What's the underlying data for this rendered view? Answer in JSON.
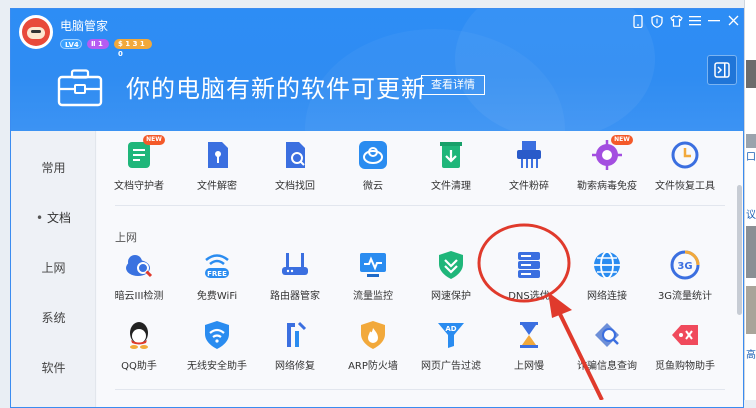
{
  "app": {
    "title": "电脑管家",
    "badges": [
      "LV4",
      "Ⅱ 1",
      "$ 1 3 1 0"
    ]
  },
  "window_controls": [
    "phone-icon",
    "shield-icon",
    "shirt-icon",
    "menu-icon",
    "minimize-icon",
    "close-icon"
  ],
  "banner": {
    "notice": "你的电脑有新的软件可更新",
    "detail_button": "查看详情"
  },
  "sidebar": {
    "items": [
      {
        "label": "常用",
        "active": false
      },
      {
        "label": "文档",
        "active": true
      },
      {
        "label": "上网",
        "active": false
      },
      {
        "label": "系统",
        "active": false
      },
      {
        "label": "软件",
        "active": false
      }
    ]
  },
  "sections": {
    "docs_tools": [
      {
        "label": "文档守护者",
        "icon": "doc-guard-icon",
        "new": true
      },
      {
        "label": "文件解密",
        "icon": "file-decrypt-icon",
        "new": false
      },
      {
        "label": "文档找回",
        "icon": "doc-recover-icon",
        "new": false
      },
      {
        "label": "微云",
        "icon": "weiyun-icon",
        "new": false
      },
      {
        "label": "文件清理",
        "icon": "file-clean-icon",
        "new": false
      },
      {
        "label": "文件粉碎",
        "icon": "file-shred-icon",
        "new": false
      },
      {
        "label": "勒索病毒免疫",
        "icon": "ransomware-immune-icon",
        "new": true
      },
      {
        "label": "文件恢复工具",
        "icon": "file-restore-icon",
        "new": false
      }
    ],
    "network": {
      "label": "上网",
      "row1": [
        {
          "label": "暗云III检测",
          "icon": "cloud-scan-icon"
        },
        {
          "label": "免费WiFi",
          "icon": "free-wifi-icon"
        },
        {
          "label": "路由器管家",
          "icon": "router-icon"
        },
        {
          "label": "流量监控",
          "icon": "traffic-monitor-icon"
        },
        {
          "label": "网速保护",
          "icon": "speed-protect-icon"
        },
        {
          "label": "DNS选优",
          "icon": "dns-server-icon"
        },
        {
          "label": "网络连接",
          "icon": "globe-icon"
        },
        {
          "label": "3G流量统计",
          "icon": "3g-stats-icon"
        }
      ],
      "row2": [
        {
          "label": "QQ助手",
          "icon": "qq-icon"
        },
        {
          "label": "无线安全助手",
          "icon": "wifi-shield-icon"
        },
        {
          "label": "网络修复",
          "icon": "network-repair-icon"
        },
        {
          "label": "ARP防火墙",
          "icon": "arp-firewall-icon"
        },
        {
          "label": "网页广告过滤",
          "icon": "ad-filter-icon"
        },
        {
          "label": "上网慢",
          "icon": "hourglass-icon"
        },
        {
          "label": "诈骗信息查询",
          "icon": "fraud-check-icon"
        },
        {
          "label": "觅鱼购物助手",
          "icon": "shopping-tag-icon"
        }
      ]
    }
  },
  "new_tag": "NEW",
  "background_window": {
    "text": [
      "口",
      "议",
      "高"
    ]
  },
  "colors": {
    "header": "#2f8cf2",
    "accent_red": "#e03a2c",
    "new_tag": "#f45a2a"
  }
}
